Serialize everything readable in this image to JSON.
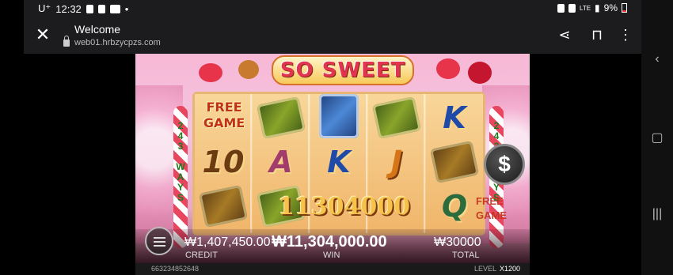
{
  "status_bar": {
    "carrier": "U⁺",
    "time": "12:32",
    "network": "LTE",
    "battery": "9%"
  },
  "browser": {
    "title": "Welcome",
    "url": "web01.hrbzycpzs.com",
    "icons": [
      "close-icon",
      "lock-icon",
      "share-icon",
      "bookmark-icon",
      "more-icon"
    ]
  },
  "nav": {
    "icons": [
      "back-icon",
      "home-icon",
      "recents-icon"
    ]
  },
  "game": {
    "logo": "SO SWEET",
    "free_game_line1": "FREE",
    "free_game_line2": "GAME",
    "ways_left": "243 WAYS",
    "ways_right": "243 WAYS",
    "dollar": "$",
    "big_win": "11304000",
    "ghost_free_line1": "FREE",
    "ghost_free_line2": "GAME",
    "reels": [
      [
        "",
        "10",
        "choc"
      ],
      [
        "green",
        "A",
        "green"
      ],
      [
        "blue",
        "K",
        ""
      ],
      [
        "green",
        "J",
        ""
      ],
      [
        "K",
        "choc",
        "Q"
      ]
    ],
    "hud": {
      "credit_value": "₩1,407,450.00",
      "credit_label": "CREDIT",
      "win_value": "₩11,304,000.00",
      "win_label": "WIN",
      "total_value": "₩30000",
      "total_label": "TOTAL"
    },
    "footer": {
      "code": "663234852648",
      "level_label": "LEVEL",
      "level_value": "X1200"
    }
  }
}
